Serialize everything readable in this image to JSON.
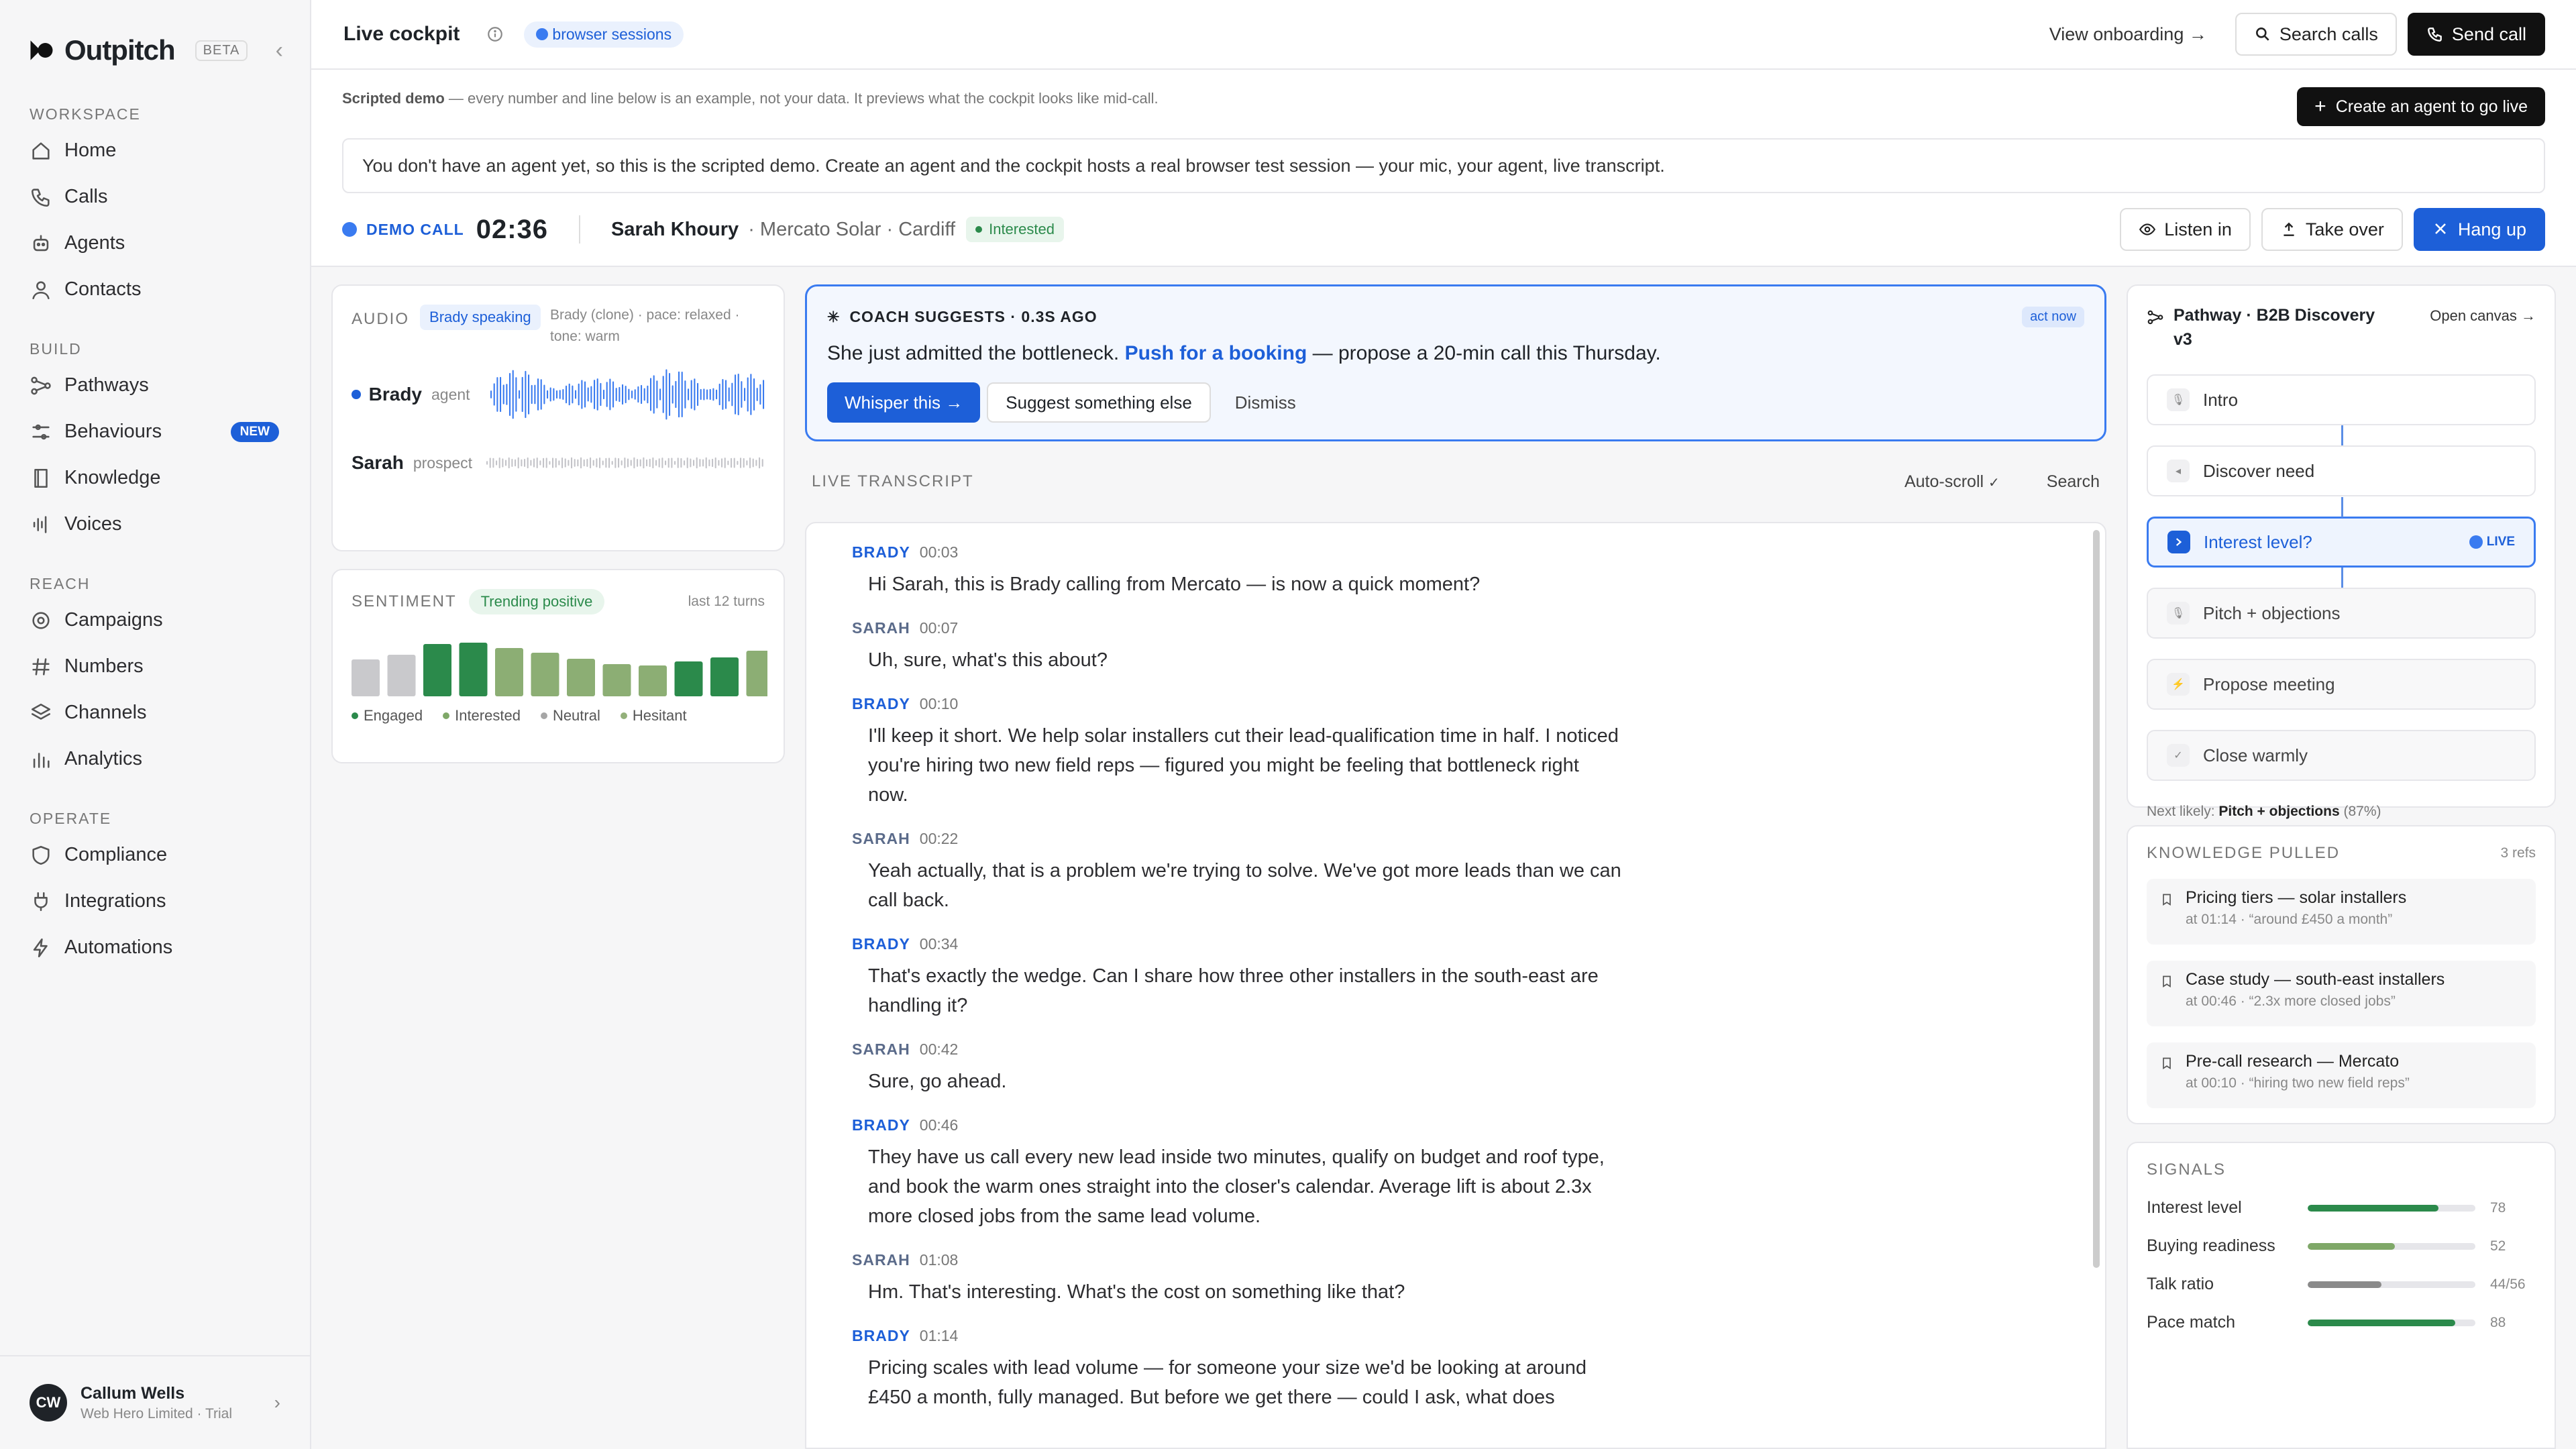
{
  "brand": {
    "name": "Outpitch",
    "badge": "BETA"
  },
  "sidebar": {
    "sections": [
      {
        "label": "WORKSPACE",
        "items": [
          {
            "label": "Home",
            "icon": "home-icon"
          },
          {
            "label": "Calls",
            "icon": "phone-icon"
          },
          {
            "label": "Agents",
            "icon": "bot-icon"
          },
          {
            "label": "Contacts",
            "icon": "user-icon"
          }
        ]
      },
      {
        "label": "BUILD",
        "items": [
          {
            "label": "Pathways",
            "icon": "pathway-icon"
          },
          {
            "label": "Behaviours",
            "icon": "sliders-icon",
            "badge": "NEW"
          },
          {
            "label": "Knowledge",
            "icon": "book-icon"
          },
          {
            "label": "Voices",
            "icon": "waveform-icon"
          }
        ]
      },
      {
        "label": "REACH",
        "items": [
          {
            "label": "Campaigns",
            "icon": "target-icon"
          },
          {
            "label": "Numbers",
            "icon": "hash-icon"
          },
          {
            "label": "Channels",
            "icon": "layers-icon"
          },
          {
            "label": "Analytics",
            "icon": "chart-icon"
          }
        ]
      },
      {
        "label": "OPERATE",
        "items": [
          {
            "label": "Compliance",
            "icon": "shield-icon"
          },
          {
            "label": "Integrations",
            "icon": "plug-icon"
          },
          {
            "label": "Automations",
            "icon": "bolt-icon"
          }
        ]
      }
    ],
    "user": {
      "initials": "CW",
      "name": "Callum Wells",
      "org": "Web Hero Limited · Trial"
    }
  },
  "topbar": {
    "title": "Live cockpit",
    "session_pill": "browser sessions",
    "onboarding": "View onboarding →",
    "search": "Search calls",
    "send": "Send call"
  },
  "demo": {
    "lead": "Scripted demo",
    "text": " — every number and line below is an example, not your data. It previews what the cockpit looks like mid-call.",
    "create": "Create an agent to go live",
    "banner": "You don't have an agent yet, so this is the scripted demo. Create an agent and the cockpit hosts a real browser test session — your mic, your agent, live transcript."
  },
  "call": {
    "tag": "DEMO CALL",
    "timer": "02:36",
    "caller": "Sarah Khoury",
    "meta": "· Mercato Solar · Cardiff",
    "status": "Interested",
    "listen": "Listen in",
    "takeover": "Take over",
    "hangup": "Hang up"
  },
  "audio": {
    "label": "AUDIO",
    "speaking": "Brady speaking",
    "voice_meta": "Brady (clone) · pace: relaxed · tone: warm",
    "agent_name": "Brady",
    "agent_role": "agent",
    "prospect_name": "Sarah",
    "prospect_role": "prospect",
    "agent_color": "#3a7bf0"
  },
  "sentiment": {
    "label": "SENTIMENT",
    "trend": "Trending positive",
    "range": "last 12 turns",
    "bars": [
      {
        "level": 0.55,
        "kind": "Hesitant"
      },
      {
        "level": 0.62,
        "kind": "Hesitant"
      },
      {
        "level": 0.78,
        "kind": "Engaged"
      },
      {
        "level": 0.8,
        "kind": "Engaged"
      },
      {
        "level": 0.72,
        "kind": "Interested"
      },
      {
        "level": 0.65,
        "kind": "Interested"
      },
      {
        "level": 0.56,
        "kind": "Interested"
      },
      {
        "level": 0.48,
        "kind": "Interested"
      },
      {
        "level": 0.46,
        "kind": "Interested"
      },
      {
        "level": 0.52,
        "kind": "Engaged"
      },
      {
        "level": 0.58,
        "kind": "Engaged"
      },
      {
        "level": 0.68,
        "kind": "Interested"
      }
    ],
    "legend": [
      {
        "label": "Engaged",
        "color": "#2b8a4b"
      },
      {
        "label": "Interested",
        "color": "#7fa868"
      },
      {
        "label": "Neutral",
        "color": "#a6a6a6"
      },
      {
        "label": "Hesitant",
        "color": "#93b07a"
      }
    ],
    "colors": {
      "Engaged": "#2b8a4b",
      "Interested": "#8cae74",
      "Neutral": "#c9c9cc",
      "Hesitant": "#c9c9cc"
    }
  },
  "coach": {
    "head": "COACH SUGGESTS · 0.3S AGO",
    "badge": "act now",
    "msg_pre": "She just admitted the bottleneck. ",
    "msg_hl": "Push for a booking",
    "msg_post": " — propose a 20-min call this Thursday.",
    "whisper": "Whisper this →",
    "suggest": "Suggest something else",
    "dismiss": "Dismiss"
  },
  "transcript": {
    "label": "LIVE TRANSCRIPT",
    "autoscroll": "Auto-scroll",
    "search": "Search",
    "turns": [
      {
        "who": "BRADY",
        "t": "00:03",
        "text": "Hi Sarah, this is Brady calling from Mercato — is now a quick moment?"
      },
      {
        "who": "SARAH",
        "t": "00:07",
        "text": "Uh, sure, what's this about?"
      },
      {
        "who": "BRADY",
        "t": "00:10",
        "text": "I'll keep it short. We help solar installers cut their lead-qualification time in half. I noticed you're hiring two new field reps — figured you might be feeling that bottleneck right now."
      },
      {
        "who": "SARAH",
        "t": "00:22",
        "text": "Yeah actually, that is a problem we're trying to solve. We've got more leads than we can call back."
      },
      {
        "who": "BRADY",
        "t": "00:34",
        "text": "That's exactly the wedge. Can I share how three other installers in the south-east are handling it?"
      },
      {
        "who": "SARAH",
        "t": "00:42",
        "text": "Sure, go ahead."
      },
      {
        "who": "BRADY",
        "t": "00:46",
        "text": "They have us call every new lead inside two minutes, qualify on budget and roof type, and book the warm ones straight into the closer's calendar. Average lift is about 2.3x more closed jobs from the same lead volume."
      },
      {
        "who": "SARAH",
        "t": "01:08",
        "text": "Hm. That's interesting. What's the cost on something like that?"
      },
      {
        "who": "BRADY",
        "t": "01:14",
        "text": "Pricing scales with lead volume — for someone your size we'd be looking at around £450 a month, fully managed. But before we get there — could I ask, what does"
      }
    ]
  },
  "pathway": {
    "title": "Pathway · B2B Discovery v3",
    "open": "Open canvas →",
    "live": "LIVE",
    "steps": [
      {
        "label": "Intro",
        "state": "done"
      },
      {
        "label": "Discover need",
        "state": "done"
      },
      {
        "label": "Interest level?",
        "state": "active"
      },
      {
        "label": "Pitch + objections",
        "state": "todo"
      },
      {
        "label": "Propose meeting",
        "state": "todo"
      },
      {
        "label": "Close warmly",
        "state": "todo"
      }
    ],
    "next_label": "Next likely: ",
    "next_step": "Pitch + objections",
    "next_pct": "(87%)"
  },
  "knowledge": {
    "label": "KNOWLEDGE PULLED",
    "refs": "3 refs",
    "items": [
      {
        "title": "Pricing tiers — solar installers",
        "sub": "at 01:14 · “around £450 a month”"
      },
      {
        "title": "Case study — south-east installers",
        "sub": "at 00:46 · “2.3x more closed jobs”"
      },
      {
        "title": "Pre-call research — Mercato",
        "sub": "at 00:10 · “hiring two new field reps”"
      }
    ]
  },
  "signals": {
    "label": "SIGNALS",
    "items": [
      {
        "name": "Interest level",
        "value": "78",
        "level": 0.78,
        "color": "#2b8a4b"
      },
      {
        "name": "Buying readiness",
        "value": "52",
        "level": 0.52,
        "color": "#7fa868"
      },
      {
        "name": "Talk ratio",
        "value": "44/56",
        "level": 0.44,
        "color": "#8a8a8a"
      },
      {
        "name": "Pace match",
        "value": "88",
        "level": 0.88,
        "color": "#2b8a4b"
      }
    ]
  }
}
